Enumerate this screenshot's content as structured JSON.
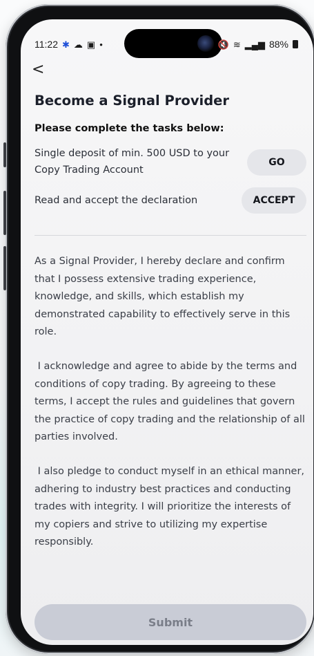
{
  "status_bar": {
    "time": "11:22",
    "left_icons": [
      "asterisk-icon",
      "cloud-icon",
      "image-icon",
      "dot-icon"
    ],
    "battery": "88%",
    "right_icons": [
      "mute-icon",
      "wifi-icon",
      "signal-icon",
      "battery-icon"
    ]
  },
  "nav": {
    "back_glyph": "<"
  },
  "header": {
    "title": "Become a Signal Provider",
    "subtitle": "Please complete the tasks below:"
  },
  "tasks": [
    {
      "text": "Single deposit of min. 500 USD to your Copy Trading Account",
      "action": "GO"
    },
    {
      "text": "Read and accept the declaration",
      "action": "ACCEPT"
    }
  ],
  "declaration": {
    "p1": "As a Signal Provider, I hereby declare and confirm that I possess extensive trading experience, knowledge, and skills, which establish my demonstrated capability to effectively serve in this role.",
    "p2": " I acknowledge and agree to abide by the terms and conditions of copy trading. By agreeing to these terms, I accept the rules and guidelines that govern the practice of copy trading and the relationship of all parties involved.",
    "p3": " I also pledge to conduct myself in an ethical manner, adhering to industry best practices and conducting trades with integrity. I will prioritize the interests of my copiers and strive to utilizing my expertise responsibly."
  },
  "footer": {
    "submit_label": "Submit",
    "submit_enabled": false
  },
  "colors": {
    "pill_bg": "#e5e6ea",
    "submit_bg": "#c9ccd6",
    "submit_text": "#7a7e89",
    "title_text": "#1b1f2a"
  }
}
